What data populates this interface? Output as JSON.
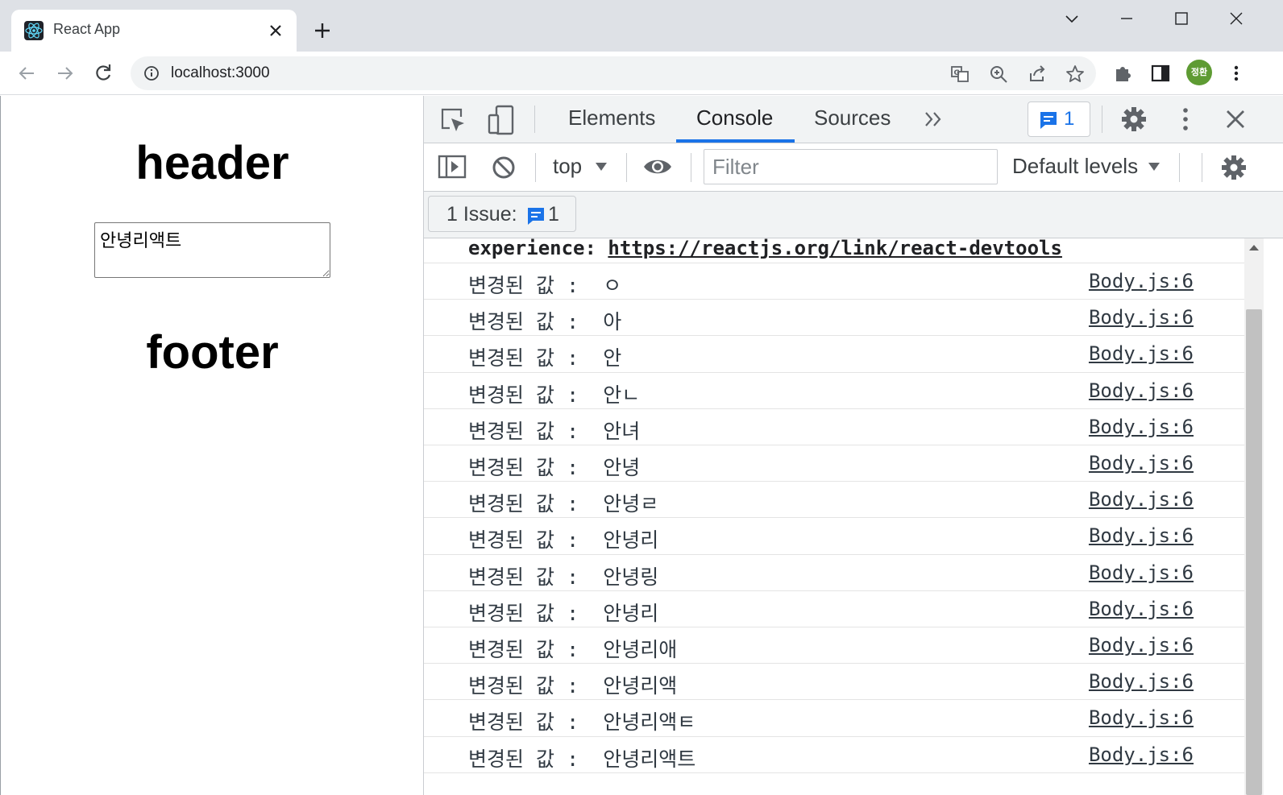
{
  "browser": {
    "tab_title": "React App",
    "url": "localhost:3000",
    "profile_initials": "정환"
  },
  "page": {
    "header": "header",
    "textarea_value": "안녕리액트",
    "footer": "footer"
  },
  "devtools": {
    "tabs": [
      "Elements",
      "Console",
      "Sources"
    ],
    "active_tab": "Console",
    "issues_badge_count": "1",
    "context": "top",
    "filter_placeholder": "Filter",
    "levels": "Default levels",
    "issue_bar_label": "1 Issue:",
    "issue_bar_count": "1",
    "first_line_label": "experience:",
    "first_line_link": "https://reactjs.org/link/react-devtools",
    "log_entries": [
      {
        "message": "변경된 값 :  ㅇ",
        "source": "Body.js:6"
      },
      {
        "message": "변경된 값 :  아",
        "source": "Body.js:6"
      },
      {
        "message": "변경된 값 :  안",
        "source": "Body.js:6"
      },
      {
        "message": "변경된 값 :  안ㄴ",
        "source": "Body.js:6"
      },
      {
        "message": "변경된 값 :  안녀",
        "source": "Body.js:6"
      },
      {
        "message": "변경된 값 :  안녕",
        "source": "Body.js:6"
      },
      {
        "message": "변경된 값 :  안녕ㄹ",
        "source": "Body.js:6"
      },
      {
        "message": "변경된 값 :  안녕리",
        "source": "Body.js:6"
      },
      {
        "message": "변경된 값 :  안녕링",
        "source": "Body.js:6"
      },
      {
        "message": "변경된 값 :  안녕리",
        "source": "Body.js:6"
      },
      {
        "message": "변경된 값 :  안녕리애",
        "source": "Body.js:6"
      },
      {
        "message": "변경된 값 :  안녕리액",
        "source": "Body.js:6"
      },
      {
        "message": "변경된 값 :  안녕리액ㅌ",
        "source": "Body.js:6"
      },
      {
        "message": "변경된 값 :  안녕리액트",
        "source": "Body.js:6"
      }
    ]
  },
  "colors": {
    "accent": "#1a73e8",
    "avatar": "#5e9b33",
    "tabstrip": "#dee1e6"
  }
}
